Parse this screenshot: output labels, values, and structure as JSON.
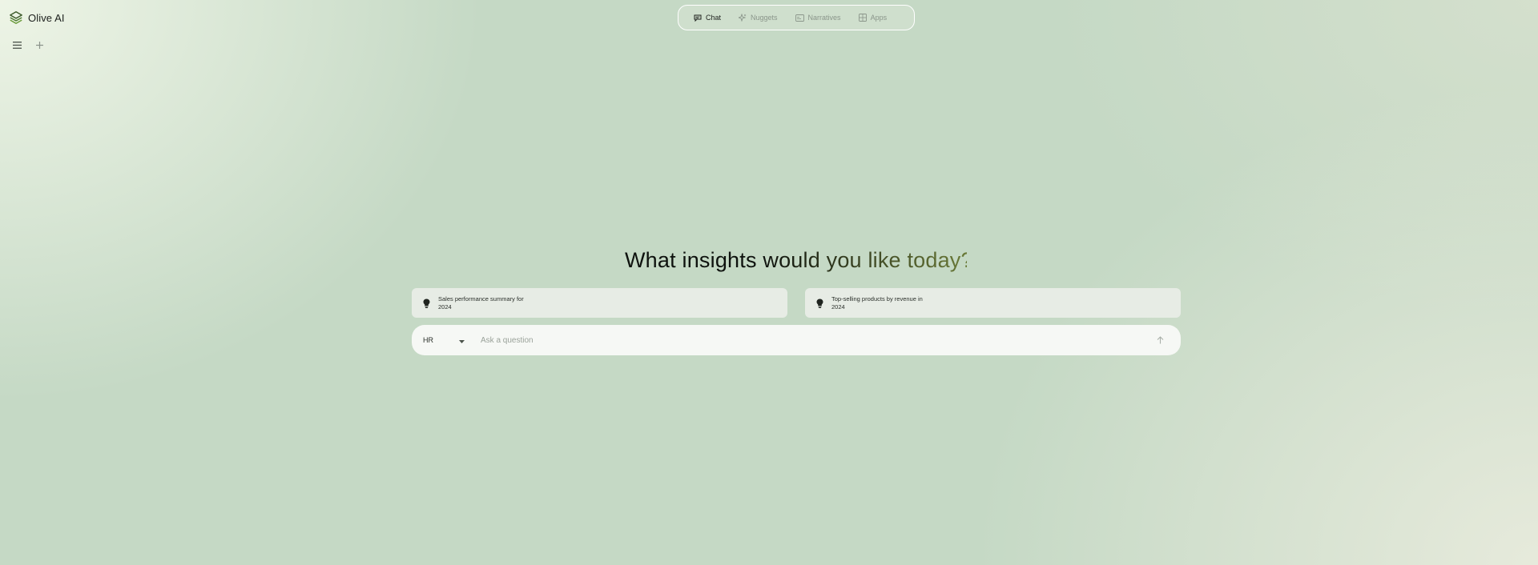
{
  "app": {
    "name": "Olive AI"
  },
  "sidebar": {
    "menu_icon": "hamburger-menu-icon",
    "new_icon": "plus-icon"
  },
  "nav": {
    "tabs": [
      {
        "label": "Chat",
        "icon": "chat-icon",
        "active": true
      },
      {
        "label": "Nuggets",
        "icon": "sparkle-icon",
        "active": false
      },
      {
        "label": "Narratives",
        "icon": "card-icon",
        "active": false
      },
      {
        "label": "Apps",
        "icon": "apps-icon",
        "active": false
      }
    ]
  },
  "main": {
    "headline": "What insights would you like today?",
    "suggestions": [
      {
        "text": "Sales performance summary for 2024",
        "icon": "lightbulb-icon"
      },
      {
        "text": "Top-selling products by revenue in 2024",
        "icon": "lightbulb-icon"
      }
    ],
    "ask": {
      "department": "HR",
      "placeholder": "Ask a question",
      "value": ""
    }
  },
  "colors": {
    "background": "#c5d9c5",
    "accent_gradient_end": "#6a7a38",
    "suggestion_bg": "#e7ece5",
    "input_bg": "#f6f8f5"
  }
}
